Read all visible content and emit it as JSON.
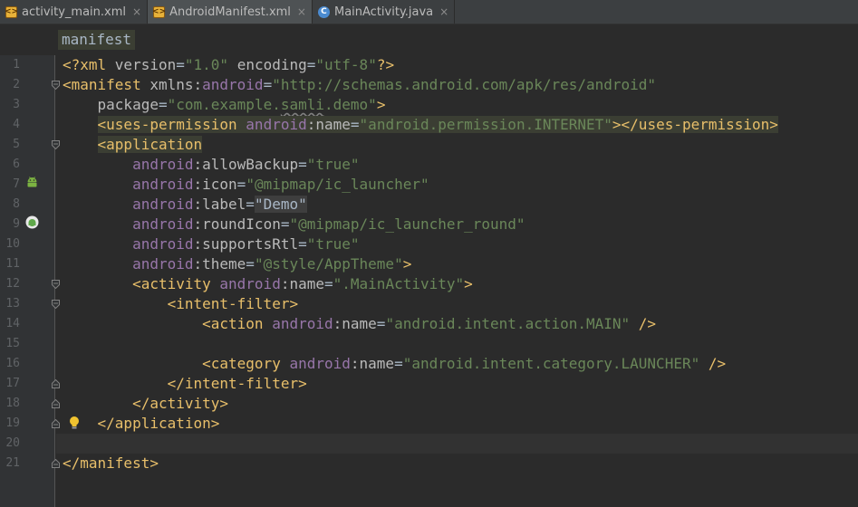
{
  "tabs": [
    {
      "label": "activity_main.xml",
      "icon": "xml-file-icon",
      "active": false
    },
    {
      "label": "AndroidManifest.xml",
      "icon": "xml-file-icon",
      "active": true
    },
    {
      "label": "MainActivity.java",
      "icon": "java-class-icon",
      "active": false
    }
  ],
  "close_glyph": "×",
  "breadcrumb": "manifest",
  "line_numbers": [
    "1",
    "2",
    "3",
    "4",
    "5",
    "6",
    "7",
    "8",
    "9",
    "10",
    "11",
    "12",
    "13",
    "14",
    "15",
    "16",
    "17",
    "18",
    "19",
    "20",
    "21"
  ],
  "colors": {
    "background": "#2b2b2b",
    "gutter": "#313335",
    "tag": "#e8bf6a",
    "attribute": "#bababa",
    "namespace": "#9876aa",
    "string": "#6a8759"
  },
  "code": {
    "l1": {
      "a": "<?xml ",
      "b": "version",
      "c": "=",
      "d": "\"1.0\"",
      "e": " ",
      "f": "encoding",
      "g": "=",
      "h": "\"utf-8\"",
      "i": "?>"
    },
    "l2": {
      "a": "<manifest ",
      "b": "xmlns:",
      "c": "android",
      "d": "=",
      "e": "\"http://schemas.android.com/apk/res/android\""
    },
    "l3": {
      "a": "package",
      "b": "=",
      "c": "\"com.example.",
      "d": "samli",
      "e": ".demo\"",
      "f": ">"
    },
    "l4": {
      "a": "<uses-permission ",
      "b": "android",
      "c": ":name",
      "d": "=",
      "e": "\"android.permission.INTERNET\"",
      "f": "></uses-permission>"
    },
    "l5": {
      "a": "<application"
    },
    "l6": {
      "a": "android",
      "b": ":allowBackup",
      "c": "=",
      "d": "\"true\""
    },
    "l7": {
      "a": "android",
      "b": ":icon",
      "c": "=",
      "d": "\"@mipmap/ic_launcher\""
    },
    "l8": {
      "a": "android",
      "b": ":label",
      "c": "=",
      "d": "\"Demo\""
    },
    "l9": {
      "a": "android",
      "b": ":roundIcon",
      "c": "=",
      "d": "\"@mipmap/ic_launcher_round\""
    },
    "l10": {
      "a": "android",
      "b": ":supportsRtl",
      "c": "=",
      "d": "\"true\""
    },
    "l11": {
      "a": "android",
      "b": ":theme",
      "c": "=",
      "d": "\"@style/AppTheme\"",
      "e": ">"
    },
    "l12": {
      "a": "<activity ",
      "b": "android",
      "c": ":name",
      "d": "=",
      "e": "\".MainActivity\"",
      "f": ">"
    },
    "l13": {
      "a": "<intent-filter>"
    },
    "l14": {
      "a": "<action ",
      "b": "android",
      "c": ":name",
      "d": "=",
      "e": "\"android.intent.action.MAIN\"",
      "f": " />"
    },
    "l16": {
      "a": "<category ",
      "b": "android",
      "c": ":name",
      "d": "=",
      "e": "\"android.intent.category.LAUNCHER\"",
      "f": " />"
    },
    "l17": {
      "a": "</intent-filter>"
    },
    "l18": {
      "a": "</activity>"
    },
    "l19": {
      "a": "</application>"
    },
    "l21": {
      "a": "</manifest>"
    }
  }
}
